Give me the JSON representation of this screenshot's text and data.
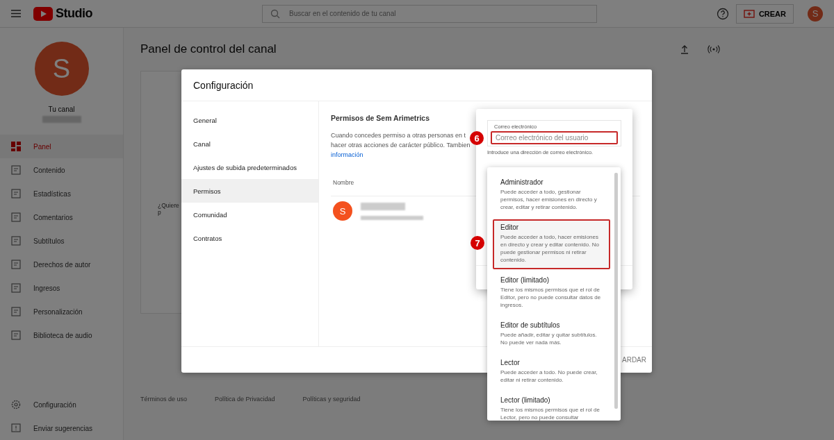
{
  "header": {
    "logo_text": "Studio",
    "search": {
      "placeholder": "Buscar en el contenido de tu canal"
    },
    "create_button": "CREAR",
    "avatar_letter": "S"
  },
  "sidebar": {
    "avatar_letter": "S",
    "channel_label": "Tu canal",
    "items": [
      {
        "label": "Panel",
        "selected": true
      },
      {
        "label": "Contenido",
        "selected": false
      },
      {
        "label": "Estadísticas",
        "selected": false
      },
      {
        "label": "Comentarios",
        "selected": false
      },
      {
        "label": "Subtítulos",
        "selected": false
      },
      {
        "label": "Derechos de autor",
        "selected": false
      },
      {
        "label": "Ingresos",
        "selected": false
      },
      {
        "label": "Personalización",
        "selected": false
      },
      {
        "label": "Biblioteca de audio",
        "selected": false
      }
    ],
    "bottom_items": [
      {
        "label": "Configuración",
        "selected": false
      },
      {
        "label": "Enviar sugerencias",
        "selected": false
      }
    ]
  },
  "main": {
    "title": "Panel de control del canal",
    "card_text": [
      "¿Quiere",
      "p"
    ],
    "footer_links": [
      "Términos de uso",
      "Política de Privacidad",
      "Políticas y seguridad"
    ]
  },
  "dialog": {
    "title": "Configuración",
    "nav": [
      {
        "label": "General",
        "selected": false
      },
      {
        "label": "Canal",
        "selected": false
      },
      {
        "label": "Ajustes de subida predeterminados",
        "selected": false
      },
      {
        "label": "Permisos",
        "selected": true
      },
      {
        "label": "Comunidad",
        "selected": false
      },
      {
        "label": "Contratos",
        "selected": false
      }
    ],
    "section_title": "Permisos de Sem Arimetrics",
    "description": [
      "Cuando concedes permiso a otras personas en t",
      "hacer otras acciones de carácter público. Tambien"
    ],
    "link": "información",
    "column": "Nombre",
    "user_avatar_letter": "S",
    "save_button": "ARDAR"
  },
  "invite_panel": {
    "email_label": "Correo electrónico",
    "email_placeholder": "Correo electrónico del usuario",
    "email_highlighted": true,
    "helper": "Introduce una dirección de correo electrónico."
  },
  "roles": [
    {
      "name": "Administrador",
      "description": "Puede acceder a todo, gestionar permisos, hacer emisiones en directo y crear, editar y retirar contenido.",
      "highlighted": false
    },
    {
      "name": "Editor",
      "description": "Puede acceder a todo, hacer emisiones en directo y crear y editar contenido. No puede gestionar permisos ni retirar contenido.",
      "highlighted": true
    },
    {
      "name": "Editor (limitado)",
      "description": "Tiene los mismos permisos que el rol de Editor, pero no puede consultar datos de ingresos.",
      "highlighted": false
    },
    {
      "name": "Editor de subtítulos",
      "description": "Puede añadir, editar y quitar subtítulos. No puede ver nada más.",
      "highlighted": false
    },
    {
      "name": "Lector",
      "description": "Puede acceder a todo. No puede crear, editar ni retirar contenido.",
      "highlighted": false
    },
    {
      "name": "Lector (limitado)",
      "description": "Tiene los mismos permisos que el rol de Lector, pero no puede consultar",
      "highlighted": false
    }
  ],
  "annotations": [
    {
      "number": "6"
    },
    {
      "number": "7"
    }
  ]
}
